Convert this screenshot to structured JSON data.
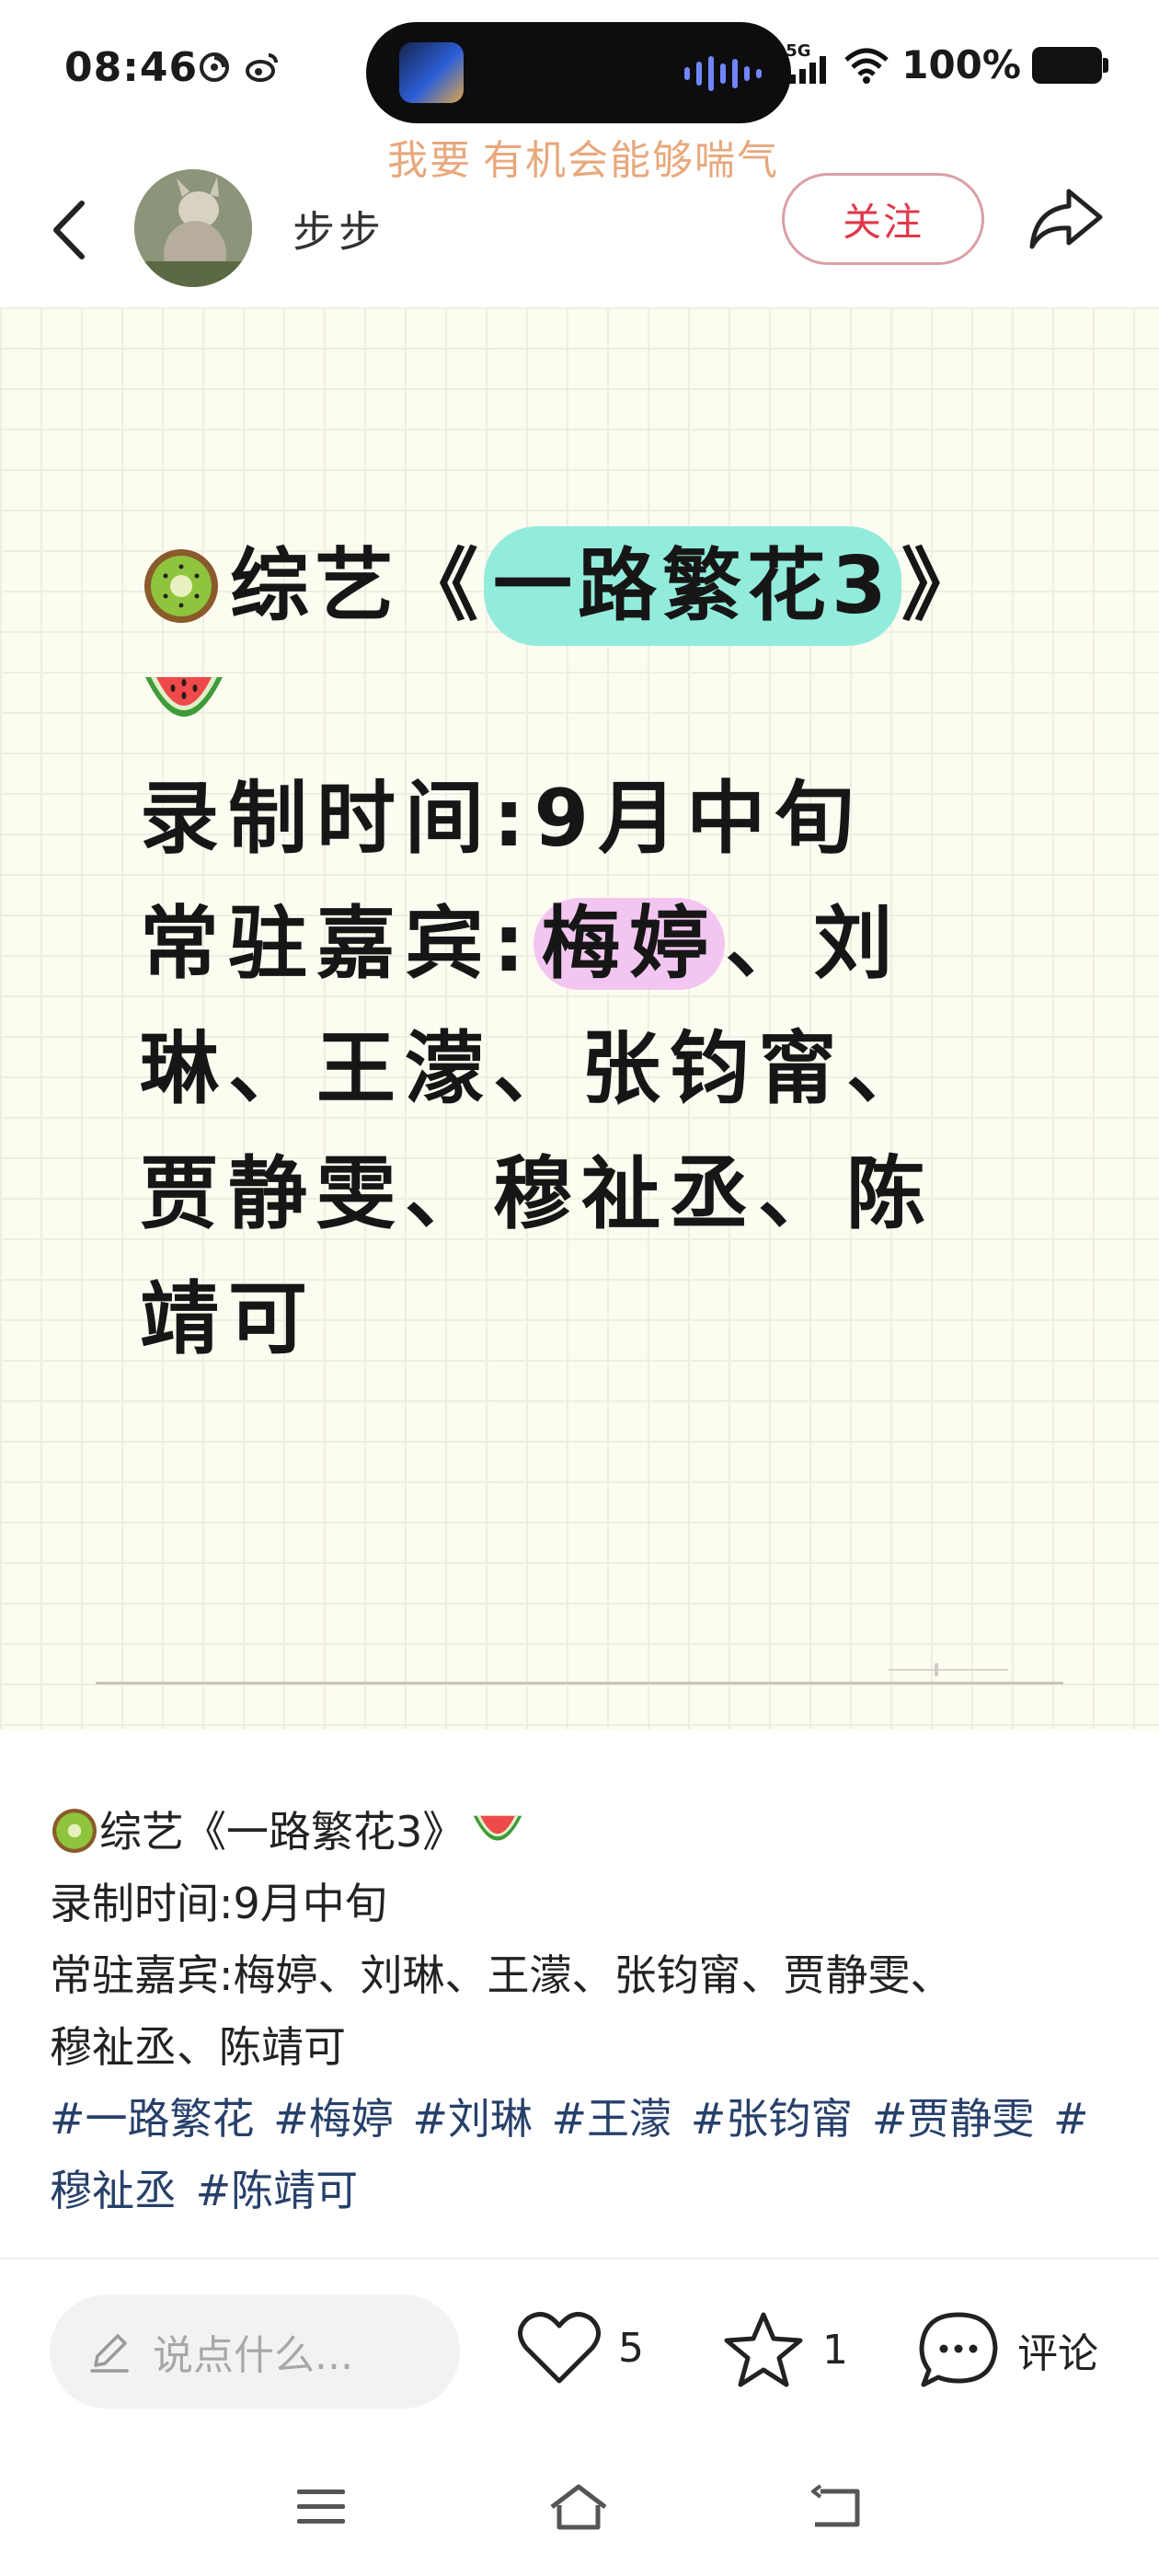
{
  "status_bar": {
    "time": "08:46",
    "network": "5G",
    "battery": "100%"
  },
  "marquee": {
    "text_1": "我要",
    "text_2": "有机会能够喘气"
  },
  "header": {
    "author_name": "步步",
    "follow_label": "关注"
  },
  "image_card": {
    "title_prefix": "综艺《",
    "title_highlight": "一路繁花3",
    "title_suffix": "》",
    "line_record": "录制时间:9月中旬",
    "line_guests_prefix": "常驻嘉宾:",
    "line_guests_highlight": "梅婷",
    "line_guests_suffix": "、刘",
    "line_guests_2": "琳、王濛、张钧甯、",
    "line_guests_3": "贾静雯、穆祉丞、陈",
    "line_guests_4": "靖可"
  },
  "post": {
    "title_text": "综艺《一路繁花3》",
    "record_line": "录制时间:9月中旬",
    "guests_line_1": "常驻嘉宾:梅婷、刘琳、王濛、张钧甯、贾静雯、",
    "guests_line_2": "穆祉丞、陈靖可",
    "tags_line_1": [
      "#一路繁花",
      "#梅婷",
      "#刘琳",
      "#王濛",
      "#张钧甯",
      "#贾静雯",
      "#"
    ],
    "tags_line_2": [
      "穆祉丞",
      "#陈靖可"
    ]
  },
  "action_bar": {
    "comment_placeholder": "说点什么...",
    "like_count": "5",
    "favorite_count": "1",
    "comment_label": "评论"
  },
  "icons": {
    "back": "chevron-left-icon",
    "share": "share-arrow-icon",
    "like": "heart-icon",
    "favorite": "star-icon",
    "comment": "chat-bubble-icon",
    "edit": "pencil-icon",
    "nav_menu": "menu-icon",
    "nav_home": "home-icon",
    "nav_back": "return-icon"
  },
  "colors": {
    "follow_text": "#e0394a",
    "tag_text": "#27406a",
    "title_highlight": "#93ecdb",
    "guest_highlight": "#f2c6f0",
    "marquee_text": "#e8a87c"
  }
}
